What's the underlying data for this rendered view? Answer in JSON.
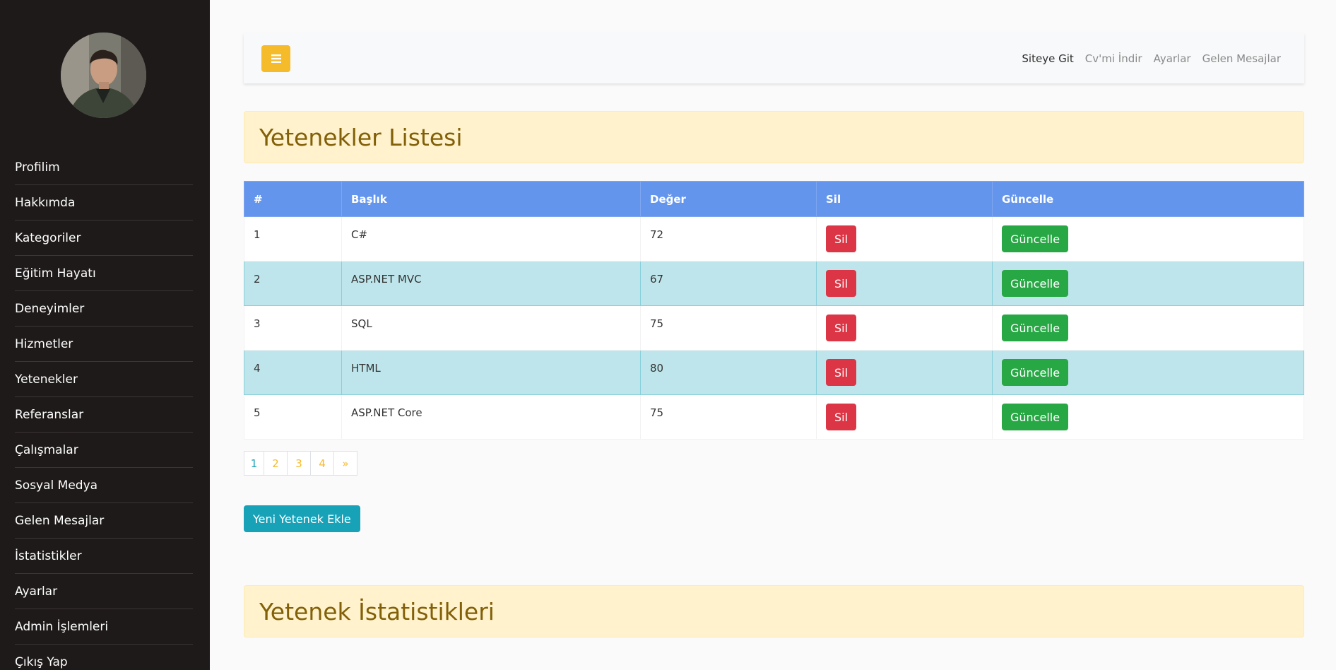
{
  "sidebar": {
    "items": [
      {
        "label": "Profilim"
      },
      {
        "label": "Hakkımda"
      },
      {
        "label": "Kategoriler"
      },
      {
        "label": "Eğitim Hayatı"
      },
      {
        "label": "Deneyimler"
      },
      {
        "label": "Hizmetler"
      },
      {
        "label": "Yetenekler"
      },
      {
        "label": "Referanslar"
      },
      {
        "label": "Çalışmalar"
      },
      {
        "label": "Sosyal Medya"
      },
      {
        "label": "Gelen Mesajlar"
      },
      {
        "label": "İstatistikler"
      },
      {
        "label": "Ayarlar"
      },
      {
        "label": "Admin İşlemleri"
      },
      {
        "label": "Çıkış Yap"
      }
    ]
  },
  "topbar": {
    "toggle_icon": "hamburger-icon",
    "links": [
      "Siteye Git",
      "Cv'mi İndir",
      "Ayarlar",
      "Gelen Mesajlar"
    ]
  },
  "main": {
    "title": "Yetenekler Listesi",
    "table": {
      "headers": [
        "#",
        "Başlık",
        "Değer",
        "Sil",
        "Güncelle"
      ],
      "rows": [
        {
          "id": "1",
          "title": "C#",
          "value": "72",
          "delete": "Sil",
          "update": "Güncelle"
        },
        {
          "id": "2",
          "title": "ASP.NET MVC",
          "value": "67",
          "delete": "Sil",
          "update": "Güncelle"
        },
        {
          "id": "3",
          "title": "SQL",
          "value": "75",
          "delete": "Sil",
          "update": "Güncelle"
        },
        {
          "id": "4",
          "title": "HTML",
          "value": "80",
          "delete": "Sil",
          "update": "Güncelle"
        },
        {
          "id": "5",
          "title": "ASP.NET Core",
          "value": "75",
          "delete": "Sil",
          "update": "Güncelle"
        }
      ]
    },
    "pagination": [
      "1",
      "2",
      "3",
      "4",
      "»"
    ],
    "add_button": "Yeni Yetenek Ekle",
    "stats_title": "Yetenek İstatistikleri"
  },
  "colors": {
    "sidebar_bg": "#1e1a19",
    "accent_yellow": "#f6bb2b",
    "table_header": "#6495ed",
    "row_highlight": "#bee5eb",
    "danger": "#dc3545",
    "success": "#28a745",
    "info": "#17a2b8",
    "section_bg": "#fff2cc",
    "section_text": "#826008"
  }
}
